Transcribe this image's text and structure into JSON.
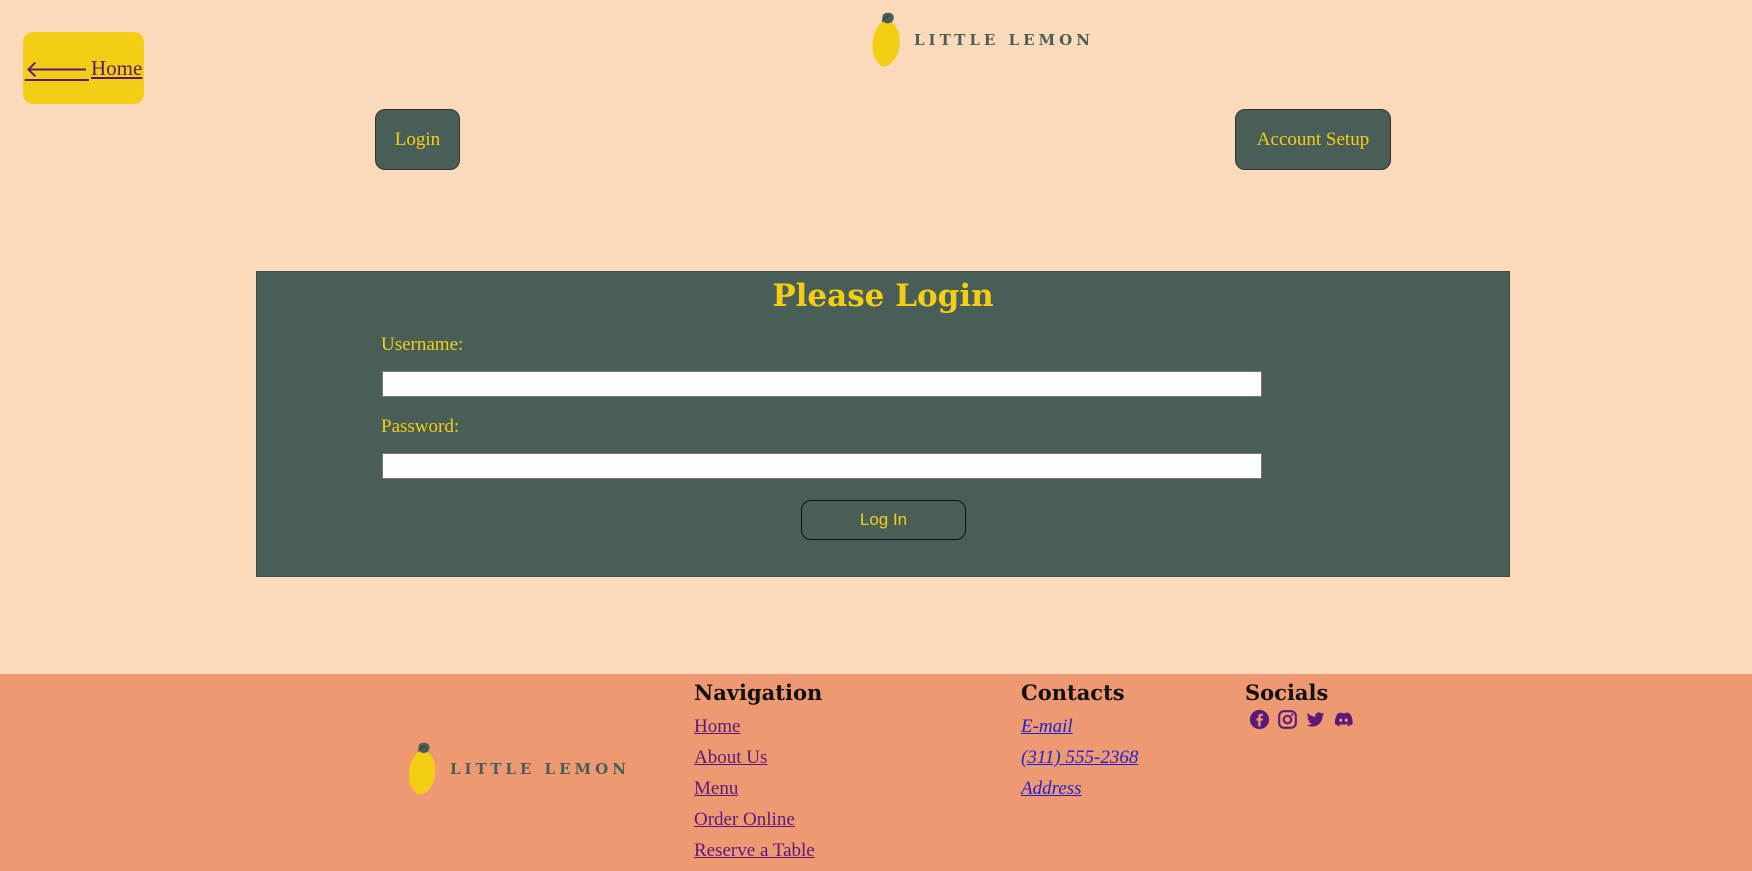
{
  "header": {
    "home_label": "Home",
    "brand_name": "LITTLE LEMON",
    "tabs": {
      "login": "Login",
      "account_setup": "Account Setup"
    }
  },
  "login_form": {
    "title": "Please Login",
    "username_label": "Username:",
    "username_value": "",
    "password_label": "Password:",
    "password_value": "",
    "submit_label": "Log In"
  },
  "footer": {
    "brand_name": "LITTLE LEMON",
    "navigation": {
      "heading": "Navigation",
      "links": [
        "Home",
        "About Us",
        "Menu",
        "Order Online",
        "Reserve a Table"
      ]
    },
    "contacts": {
      "heading": "Contacts",
      "links": [
        "E-mail",
        "(311) 555-2368",
        "Address"
      ]
    },
    "socials": {
      "heading": "Socials",
      "icons": [
        "facebook-icon",
        "instagram-icon",
        "twitter-icon",
        "discord-icon"
      ]
    }
  },
  "colors": {
    "background": "#FBDABB",
    "primary_green": "#495E57",
    "primary_yellow": "#F4CE14",
    "footer_bg": "#EE9972",
    "link_purple": "#5B1A7A",
    "link_blue": "#2222CC"
  }
}
